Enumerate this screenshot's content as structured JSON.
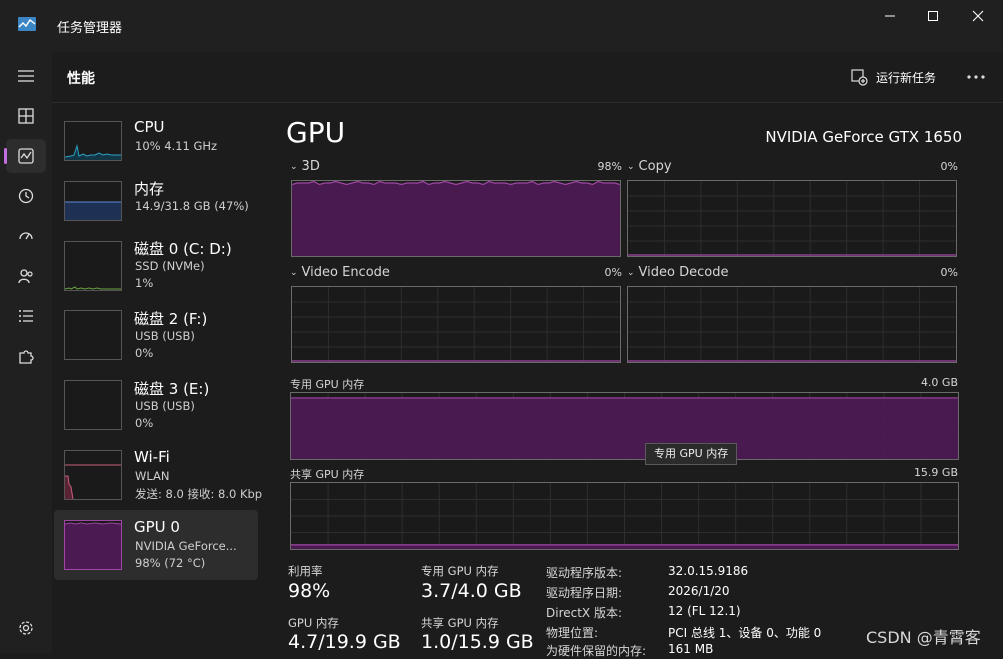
{
  "window": {
    "title": "任务管理器"
  },
  "header": {
    "title": "性能",
    "run_task": "运行新任务"
  },
  "sidebar": {
    "items": [
      {
        "name": "CPU",
        "sub1": "10% 4.11 GHz",
        "sub2": ""
      },
      {
        "name": "内存",
        "sub1": "14.9/31.8 GB (47%)",
        "sub2": ""
      },
      {
        "name": "磁盘 0 (C: D:)",
        "sub1": "SSD (NVMe)",
        "sub2": "1%"
      },
      {
        "name": "磁盘 2 (F:)",
        "sub1": "USB (USB)",
        "sub2": "0%"
      },
      {
        "name": "磁盘 3 (E:)",
        "sub1": "USB (USB)",
        "sub2": "0%"
      },
      {
        "name": "Wi-Fi",
        "sub1": "WLAN",
        "sub2": "发送: 8.0 接收: 8.0 Kbp"
      },
      {
        "name": "GPU 0",
        "sub1": "NVIDIA GeForce...",
        "sub2": "98% (72 °C)"
      }
    ]
  },
  "main": {
    "title": "GPU",
    "model": "NVIDIA GeForce GTX 1650",
    "engines": [
      {
        "label": "3D",
        "pct": "98%"
      },
      {
        "label": "Copy",
        "pct": "0%"
      },
      {
        "label": "Video Encode",
        "pct": "0%"
      },
      {
        "label": "Video Decode",
        "pct": "0%"
      }
    ],
    "dedicated": {
      "label": "专用 GPU 内存",
      "max": "4.0 GB"
    },
    "shared": {
      "label": "共享 GPU 内存",
      "max": "15.9 GB"
    },
    "tooltip": "专用 GPU 内存",
    "stats": {
      "util_label": "利用率",
      "util_value": "98%",
      "ded_label": "专用 GPU 内存",
      "ded_value": "3.7/4.0 GB",
      "gpumem_label": "GPU 内存",
      "gpumem_value": "4.7/19.9 GB",
      "shared_label": "共享 GPU 内存",
      "shared_value": "1.0/15.9 GB"
    },
    "info": [
      {
        "k": "驱动程序版本:",
        "v": "32.0.15.9186"
      },
      {
        "k": "驱动程序日期:",
        "v": "2026/1/20"
      },
      {
        "k": "DirectX 版本:",
        "v": "12 (FL 12.1)"
      },
      {
        "k": "物理位置:",
        "v": "PCI 总线 1、设备 0、功能 0"
      },
      {
        "k": "为硬件保留的内存:",
        "v": "161 MB"
      }
    ]
  },
  "watermark": "CSDN @青霄客",
  "levels": {
    "cpu": 0.1,
    "memory": 0.47,
    "disk0": 0.01,
    "disk2": 0.0,
    "disk3": 0.0,
    "gpu_3d": 0.98,
    "copy": 0.0,
    "video_encode": 0.0,
    "video_decode": 0.0,
    "dedicated_memory": 0.925,
    "shared_memory": 0.063
  },
  "colors": {
    "accent": "#c36ee0",
    "gpu_line": "#a146a6",
    "gpu_fill": "#4c1a52",
    "cpu_line": "#2ea1c4",
    "mem_line": "#5b8bd2",
    "mem_fill": "#1e3053",
    "disk_line": "#6aa443",
    "net_line": "#c8607c"
  }
}
